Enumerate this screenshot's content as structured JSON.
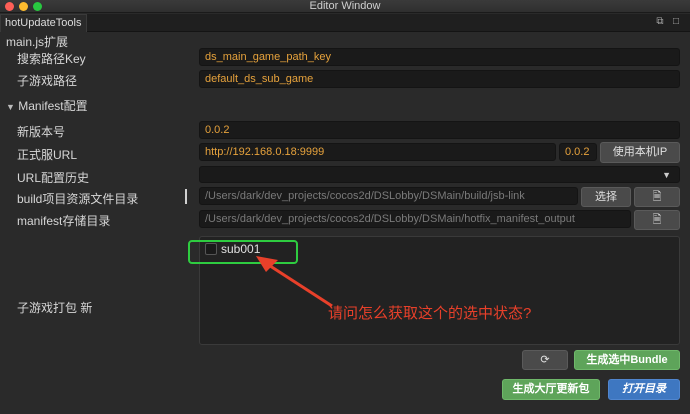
{
  "window": {
    "title": "Editor Window",
    "tab": "hotUpdateTools"
  },
  "section1": {
    "title": "main.js扩展",
    "search_key_label": "搜索路径Key",
    "search_key_value": "ds_main_game_path_key",
    "subgame_path_label": "子游戏路径",
    "subgame_path_value": "default_ds_sub_game"
  },
  "section2": {
    "title": "Manifest配置",
    "version_label": "新版本号",
    "version_value": "0.0.2",
    "url_label": "正式服URL",
    "url_value": "http://192.168.0.18:9999",
    "url_version": "0.0.2",
    "use_local_ip": "使用本机IP",
    "history_label": "URL配置历史",
    "build_dir_label": "build项目资源文件目录",
    "build_dir_value": "/Users/dark/dev_projects/cocos2d/DSLobby/DSMain/build/jsb-link",
    "select_button": "选择",
    "manifest_dir_label": "manifest存储目录",
    "manifest_dir_value": "/Users/dark/dev_projects/cocos2d/DSLobby/DSMain/hotfix_manifest_output",
    "subgame_pack_label": "子游戏打包 新",
    "subgame_item": "sub001",
    "annotation": "请问怎么获取这个的选中状态?",
    "generate_bundle": "生成选中Bundle",
    "generate_hall": "生成大厅更新包",
    "open_dir": "打开目录"
  },
  "colors": {
    "accent_green": "#5ea45a",
    "accent_blue": "#3e77c1",
    "annotation_red": "#e8402a",
    "highlight_green": "#2ecc40"
  }
}
